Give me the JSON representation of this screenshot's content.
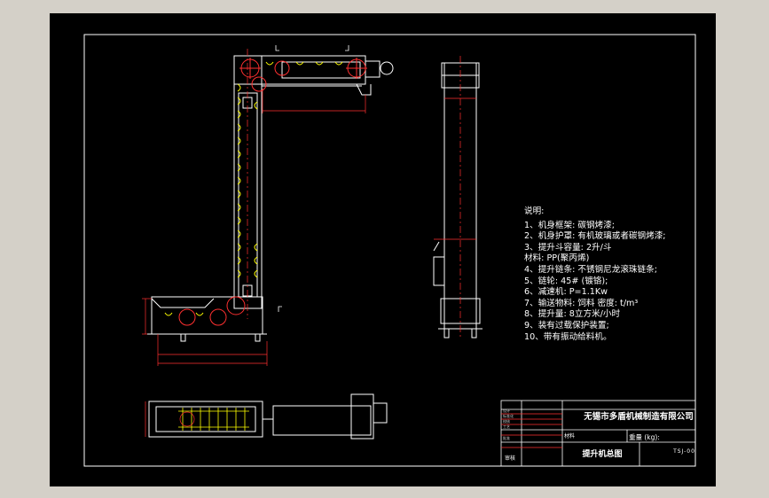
{
  "notes": {
    "title": "说明:",
    "items": [
      "1、机身框架: 碳钢烤漆;",
      "2、机身护罩: 有机玻璃或者碳钢烤漆;",
      "3、提升斗容量: 2升/斗",
      "    材料: PP(聚丙烯)",
      "4、提升链条: 不锈钢尼龙滚珠链条;",
      "5、链轮: 45# (镀铬);",
      "6、减速机:   P=1.1Kw",
      "7、输送物料: 饲料   密度:        t/m³",
      "8、提升量: 8立方米/小时",
      "9、装有过载保护装置;",
      "10、带有振动给料机。"
    ]
  },
  "title_block": {
    "company": "无锡市多盾机械制造有限公司",
    "drawing_title": "提升机总图",
    "drawing_code": "TSJ-00",
    "weight_label": "重量 (kg):",
    "material_label": "材料",
    "check_label": "审核",
    "small_labels": [
      "设计",
      "标准化",
      "校核",
      "工艺",
      "批准"
    ]
  },
  "colors": {
    "frame": "#ffffff",
    "part": "#ffffff",
    "chain": "#ffff00",
    "sprocket": "#ff3030",
    "dimension": "#ff3030",
    "center_line": "#ff3030",
    "titleblock_red": "#ff3030"
  }
}
